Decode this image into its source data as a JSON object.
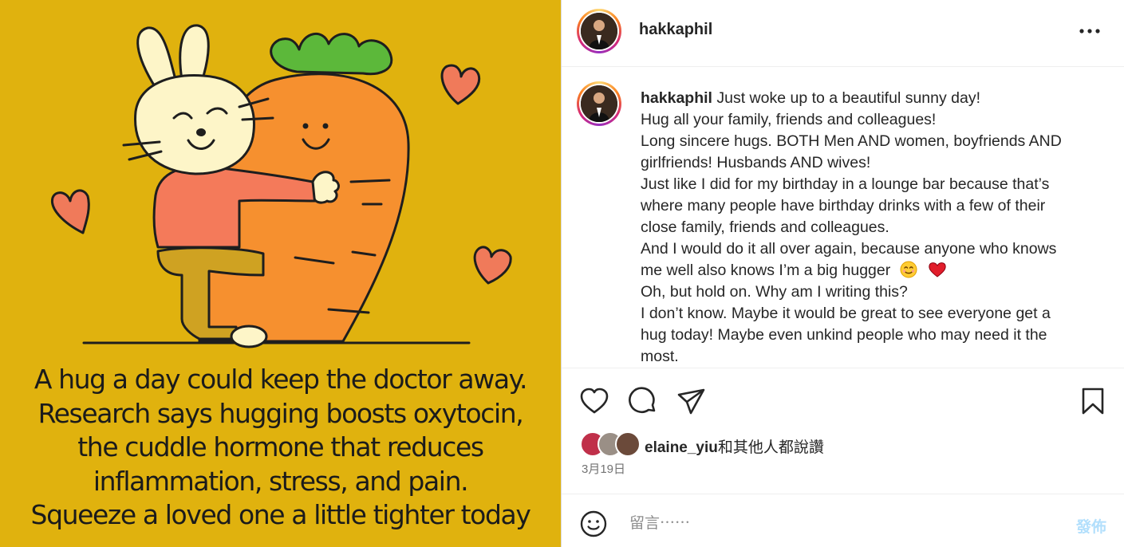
{
  "image": {
    "background_color": "#e0b20e",
    "caption_lines": [
      "A hug a day could keep the doctor away.",
      "Research says hugging boosts oxytocin,",
      "the cuddle hormone that reduces",
      "inflammation, stress, and pain.",
      "Squeeze a loved one a little tighter today"
    ]
  },
  "header": {
    "username": "hakkaphil",
    "more_icon": "more-horizontal-icon"
  },
  "caption": {
    "username": "hakkaphil",
    "lines": [
      "Just woke up to a beautiful sunny day!",
      "Hug all your family, friends and colleagues!",
      "Long sincere hugs. BOTH Men AND women, boyfriends AND",
      "girlfriends! Husbands AND wives!",
      "Just like I did for my birthday in a lounge bar because that’s",
      "where many people have birthday drinks with a few of their",
      "close family, friends and colleagues.",
      "And I would do it all over again, because anyone who knows",
      "me well also knows I’m a big hugger",
      "Oh, but hold on. Why am I writing this?",
      "I don’t know. Maybe it would be great to see everyone get a",
      "hug today! Maybe even unkind people who may need it the",
      "most."
    ],
    "emojis": [
      "smiling-face-emoji",
      "red-heart-emoji"
    ]
  },
  "actions": {
    "icons": [
      "heart-icon",
      "comment-icon",
      "share-icon",
      "bookmark-icon"
    ]
  },
  "likes": {
    "user": "elaine_yiu",
    "suffix": "和其他人都說讚"
  },
  "date": "3月19日",
  "comment": {
    "placeholder": "留言⋯⋯",
    "post_label": "發佈",
    "post_color": "#b2dffc"
  }
}
